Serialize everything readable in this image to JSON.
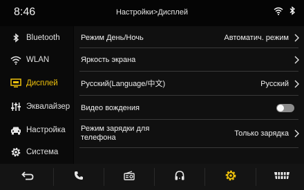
{
  "status": {
    "time": "8:46",
    "title": "Настройки>Дисплей"
  },
  "sidebar": {
    "items": [
      {
        "label": "Bluetooth",
        "icon": "bluetooth-icon"
      },
      {
        "label": "WLAN",
        "icon": "wifi-icon"
      },
      {
        "label": "Дисплей",
        "icon": "display-icon",
        "active": true
      },
      {
        "label": "Эквалайзер",
        "icon": "equalizer-icon"
      },
      {
        "label": "Настройка",
        "icon": "car-icon"
      },
      {
        "label": "Система",
        "icon": "gear-icon"
      }
    ]
  },
  "settings": {
    "rows": [
      {
        "label": "Режим День/Ночь",
        "value": "Автоматич. режим"
      },
      {
        "label": "Яркость экрана",
        "value": ""
      },
      {
        "label": "Русский(Language/中文)",
        "value": "Русский"
      },
      {
        "label": "Видео вождения",
        "toggle": false
      },
      {
        "label_line1": "Режим зарядки для",
        "label_line2": "телефона",
        "value": "Только зарядка"
      }
    ]
  },
  "dock": {
    "items": [
      "back-icon",
      "phone-icon",
      "radio-icon",
      "headphones-icon",
      "settings-icon",
      "car-grille-icon"
    ]
  },
  "colors": {
    "accent": "#f0c20c",
    "background": "#050505"
  }
}
